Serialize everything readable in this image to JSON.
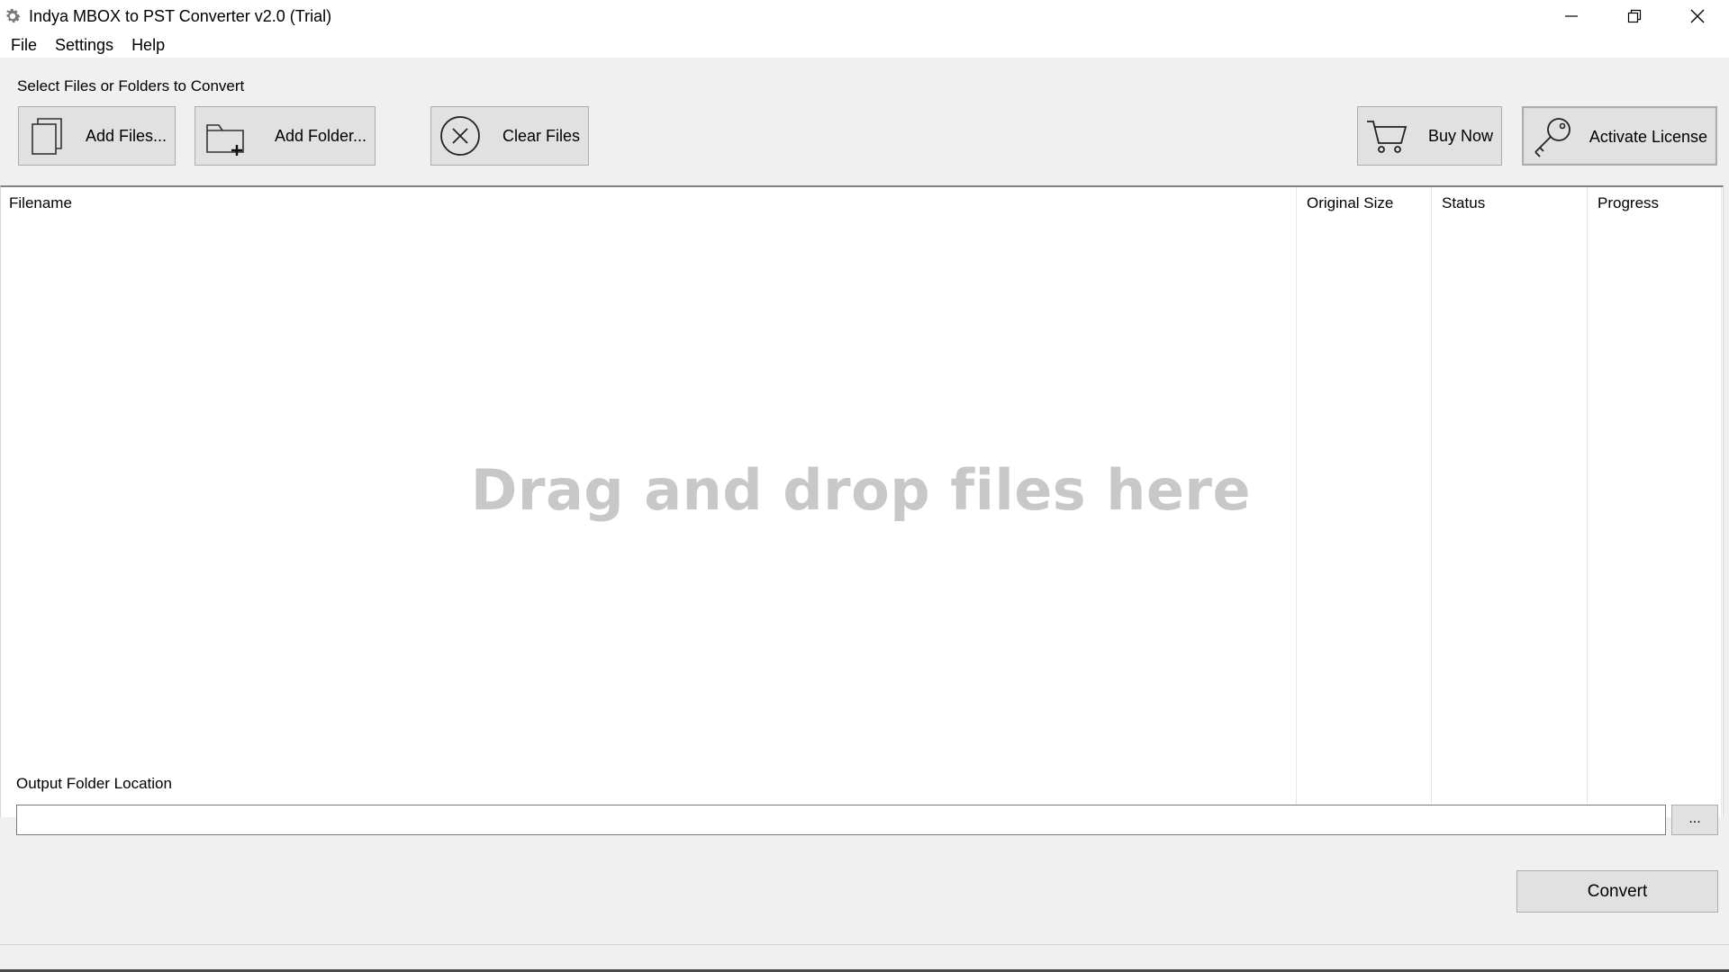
{
  "window": {
    "title": "Indya MBOX to PST Converter v2.0 (Trial)",
    "icon": "gear-icon"
  },
  "menu": {
    "items": [
      {
        "label": "File"
      },
      {
        "label": "Settings"
      },
      {
        "label": "Help"
      }
    ]
  },
  "select_section": {
    "label": "Select Files or Folders to Convert"
  },
  "toolbar": {
    "add_files": {
      "label": "Add Files...",
      "icon": "copy-files-icon"
    },
    "add_folder": {
      "label": "Add Folder...",
      "icon": "folder-add-icon"
    },
    "clear_files": {
      "label": "Clear Files",
      "icon": "circle-x-icon"
    },
    "buy_now": {
      "label": "Buy Now",
      "icon": "cart-icon"
    },
    "activate_license": {
      "label": "Activate License",
      "icon": "key-icon"
    }
  },
  "file_list": {
    "columns": [
      "Filename",
      "Original Size",
      "Status",
      "Progress"
    ],
    "rows": [],
    "empty_text": "Drag and drop files here"
  },
  "output": {
    "label": "Output Folder Location",
    "value": "",
    "placeholder": "",
    "browse_label": "..."
  },
  "actions": {
    "convert_label": "Convert"
  },
  "colors": {
    "panel_bg": "#f0f0f0",
    "button_bg": "#e1e1e1",
    "button_border": "#adadad",
    "dropzone_text": "#c8c8c8"
  }
}
